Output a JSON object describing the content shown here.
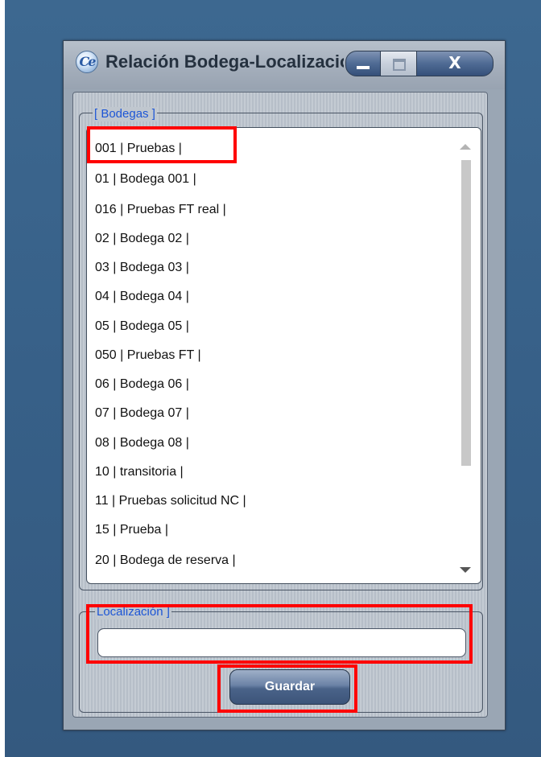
{
  "window": {
    "title": "Relación Bodega-Localización",
    "app_icon_text": "Ce",
    "close_label": "X"
  },
  "bodegas": {
    "legend": "[ Bodegas ]",
    "items": [
      "001 | Pruebas |",
      "01 | Bodega 001 |",
      "016 | Pruebas FT real |",
      "02 | Bodega 02 |",
      "03 | Bodega 03 |",
      "04 | Bodega 04 |",
      "05 | Bodega 05 |",
      "050 | Pruebas FT |",
      "06 | Bodega 06 |",
      "07 | Bodega 07 |",
      "08 | Bodega 08 |",
      "10 | transitoria |",
      "11 | Pruebas solicitud NC |",
      "15 | Prueba |",
      "20 | Bodega de reserva |"
    ]
  },
  "localizacion": {
    "legend": "Localización ]",
    "value": ""
  },
  "actions": {
    "save_label": "Guardar"
  },
  "colors": {
    "desktop": "#376088",
    "legend": "#1d56d6",
    "highlight": "#ff0000"
  }
}
